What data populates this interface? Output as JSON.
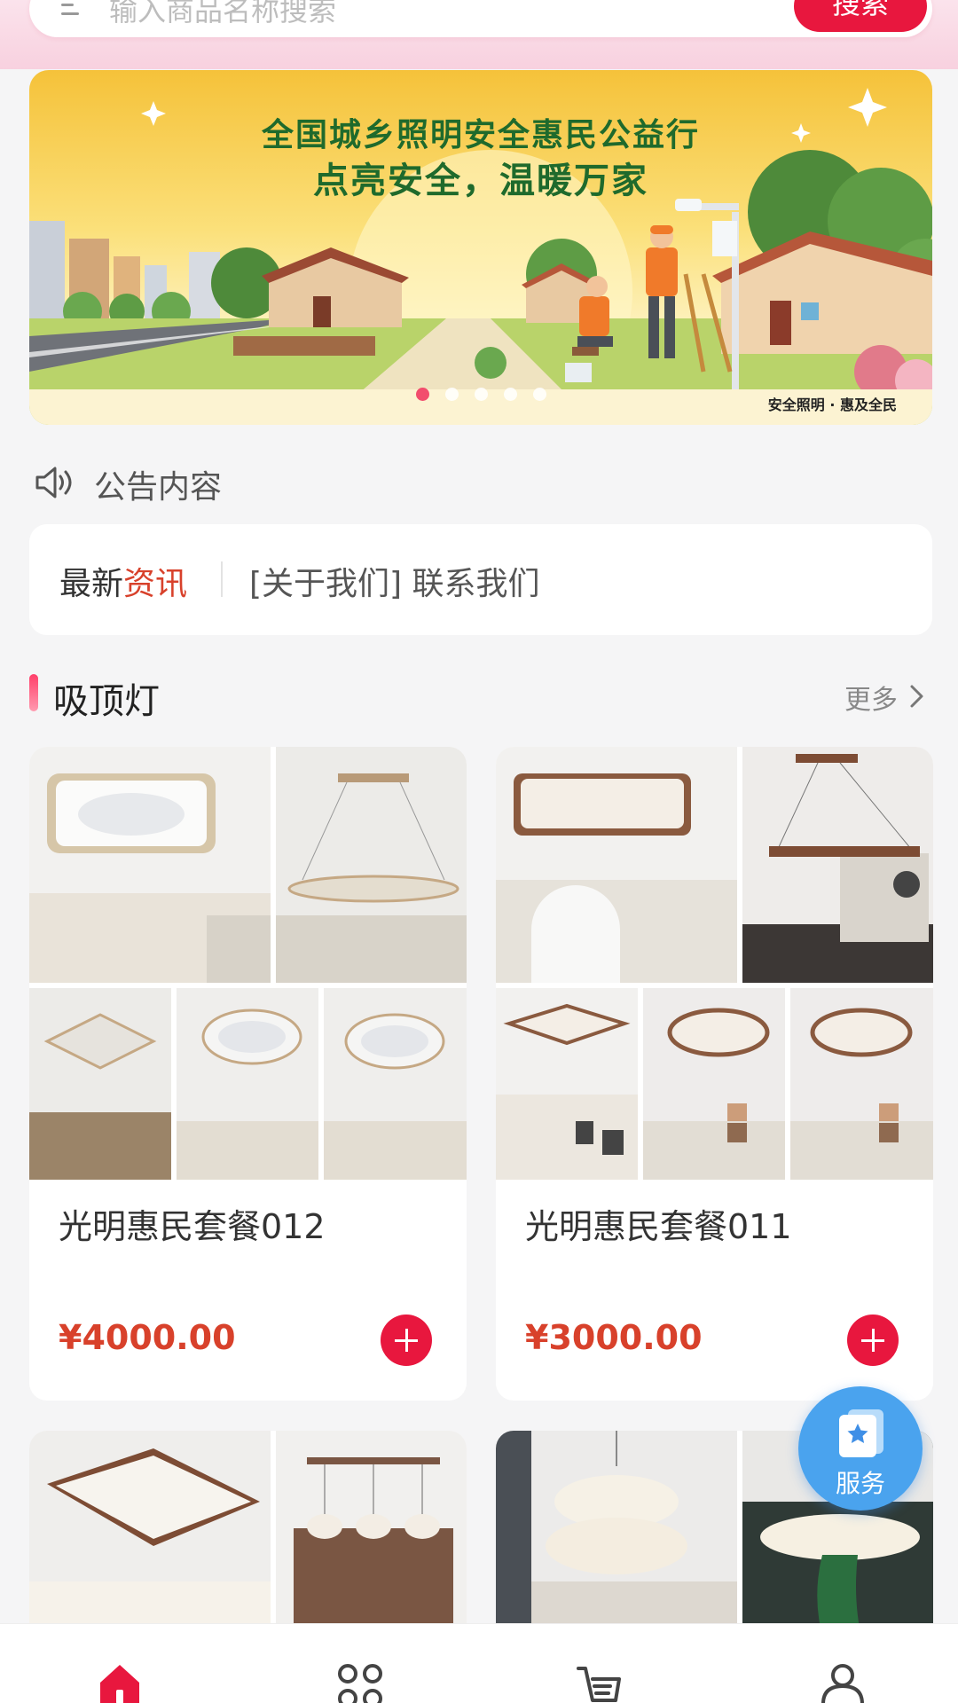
{
  "search": {
    "placeholder": "输入商品名称搜索",
    "button_label": "搜索"
  },
  "banner": {
    "title_line1": "全国城乡照明安全惠民公益行",
    "title_line2": "点亮安全，温暖万家",
    "caption": "安全照明 · 惠及全民",
    "slide_count": 5,
    "active_slide": 1
  },
  "notice": {
    "text": "公告内容"
  },
  "news": {
    "label_prefix": "最新",
    "label_highlight": "资讯",
    "text": "[关于我们] 联系我们"
  },
  "section": {
    "title": "吸顶灯",
    "more_label": "更多"
  },
  "products": [
    {
      "name": "光明惠民套餐012",
      "price": "¥4000.00"
    },
    {
      "name": "光明惠民套餐011",
      "price": "¥3000.00"
    },
    {
      "name": "",
      "price": ""
    },
    {
      "name": "",
      "price": ""
    }
  ],
  "service": {
    "label": "服务"
  },
  "tabs": [
    {
      "icon": "home-icon",
      "active": true
    },
    {
      "icon": "category-icon",
      "active": false
    },
    {
      "icon": "cart-icon",
      "active": false
    },
    {
      "icon": "user-icon",
      "active": false
    }
  ],
  "colors": {
    "accent": "#e8173e",
    "price": "#d8412b",
    "service": "#4aa3ee"
  }
}
